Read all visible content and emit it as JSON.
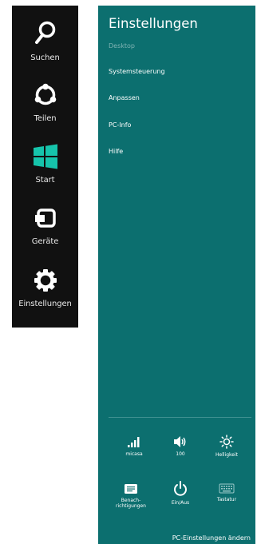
{
  "charms": {
    "items": [
      {
        "label": "Suchen",
        "icon": "search-icon"
      },
      {
        "label": "Teilen",
        "icon": "share-icon"
      },
      {
        "label": "Start",
        "icon": "windows-logo-icon"
      },
      {
        "label": "Geräte",
        "icon": "devices-icon"
      },
      {
        "label": "Einstellungen",
        "icon": "gear-icon"
      }
    ]
  },
  "settings": {
    "title": "Einstellungen",
    "subtitle": "Desktop",
    "links": [
      "Systemsteuerung",
      "Anpassen",
      "PC-Info",
      "Hilfe"
    ],
    "quick": {
      "network": "micasa",
      "volume": "100",
      "brightness": "Helligkeit",
      "notifications": "Benach-\nrichtigungen",
      "power": "Ein/Aus",
      "keyboard": "Tastatur"
    },
    "footer_link": "PC-Einstellungen ändern"
  },
  "colors": {
    "charms_bg": "#111111",
    "pane_bg": "#0c6f6f"
  }
}
